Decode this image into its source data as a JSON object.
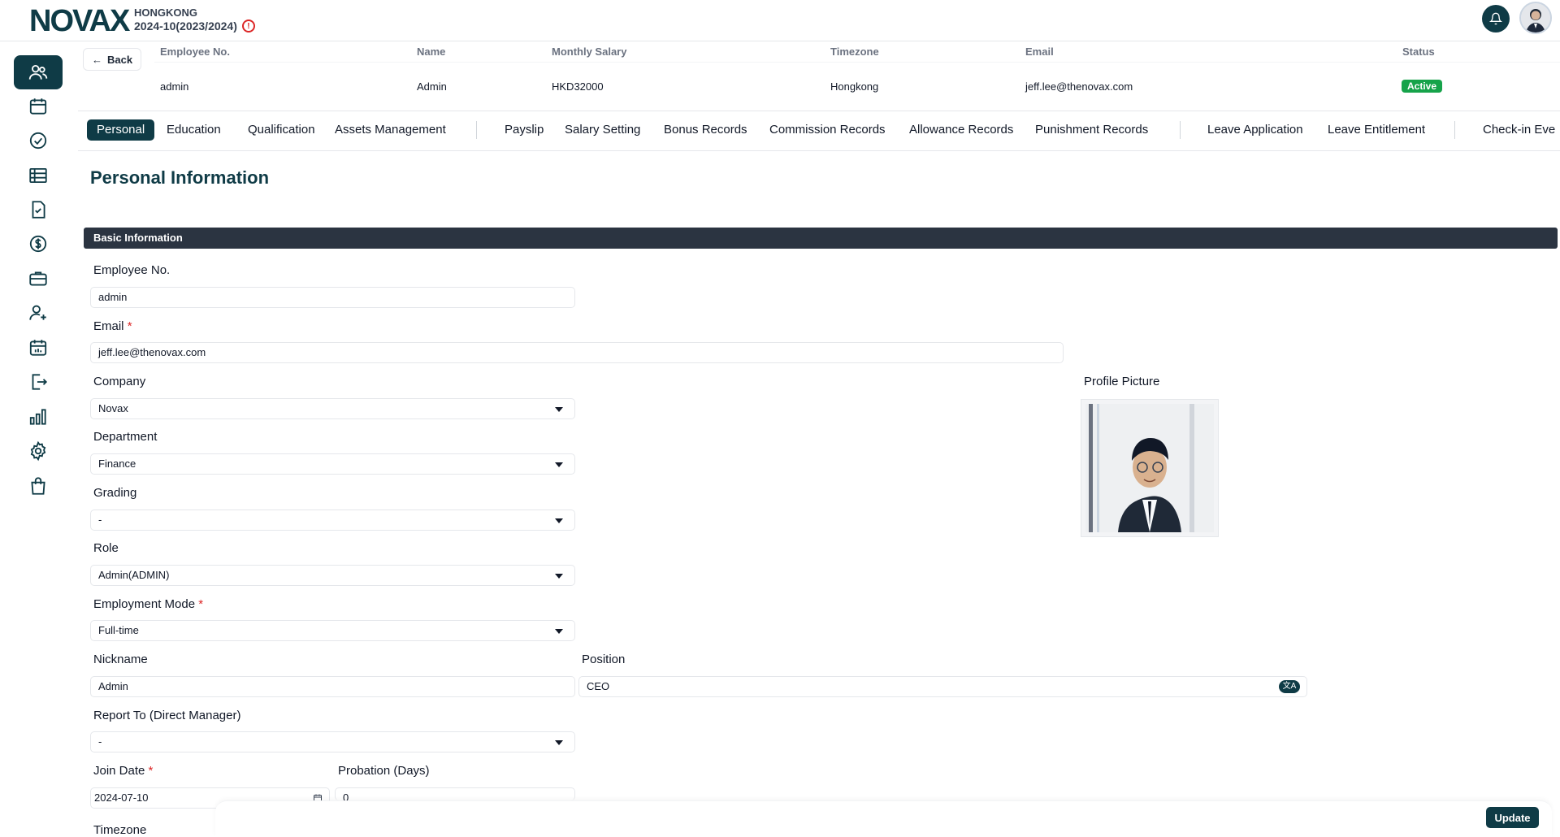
{
  "header": {
    "logo": "NOVAX",
    "org": "HONGKONG",
    "period": "2024-10(2023/2024)"
  },
  "back_label": "Back",
  "employee_table": {
    "headers": [
      "Employee No.",
      "Name",
      "Monthly Salary",
      "Timezone",
      "Email",
      "Status"
    ],
    "values": [
      "admin",
      "Admin",
      "HKD32000",
      "Hongkong",
      "jeff.lee@thenovax.com",
      "Active"
    ]
  },
  "tabs": [
    "Personal",
    "Education",
    "Qualification",
    "Assets Management",
    "Payslip",
    "Salary Setting",
    "Bonus Records",
    "Commission Records",
    "Allowance Records",
    "Punishment Records",
    "Leave Application",
    "Leave Entitlement",
    "Check-in Eve"
  ],
  "section_title": "Personal Information",
  "basic_info_label": "Basic Information",
  "form": {
    "employee_no": {
      "label": "Employee No.",
      "value": "admin"
    },
    "email": {
      "label": "Email",
      "value": "jeff.lee@thenovax.com",
      "required": "*"
    },
    "company": {
      "label": "Company",
      "value": "Novax"
    },
    "department": {
      "label": "Department",
      "value": "Finance"
    },
    "grading": {
      "label": "Grading",
      "value": "-"
    },
    "role": {
      "label": "Role",
      "value": "Admin(ADMIN)"
    },
    "employment_mode": {
      "label": "Employment Mode",
      "value": "Full-time",
      "required": "*"
    },
    "nickname": {
      "label": "Nickname",
      "value": "Admin"
    },
    "position": {
      "label": "Position",
      "value": "CEO"
    },
    "report_to": {
      "label": "Report To (Direct Manager)",
      "value": "-"
    },
    "join_date": {
      "label": "Join Date",
      "value": "2024-07-10",
      "required": "*"
    },
    "probation": {
      "label": "Probation (Days)",
      "value": "0"
    },
    "timezone": {
      "label": "Timezone"
    },
    "profile_picture": {
      "label": "Profile Picture"
    }
  },
  "update_label": "Update",
  "sidebar_icons": [
    "users-icon",
    "calendar-icon",
    "check-circle-icon",
    "table-icon",
    "document-check-icon",
    "dollar-icon",
    "briefcase-icon",
    "user-plus-icon",
    "calendar-chart-icon",
    "logout-icon",
    "bar-chart-icon",
    "gear-icon",
    "shopping-bag-icon"
  ],
  "colors": {
    "primary": "#0f3b46",
    "status_active": "#16a34a",
    "section_bar": "#2b3441",
    "required": "#dc2626"
  }
}
